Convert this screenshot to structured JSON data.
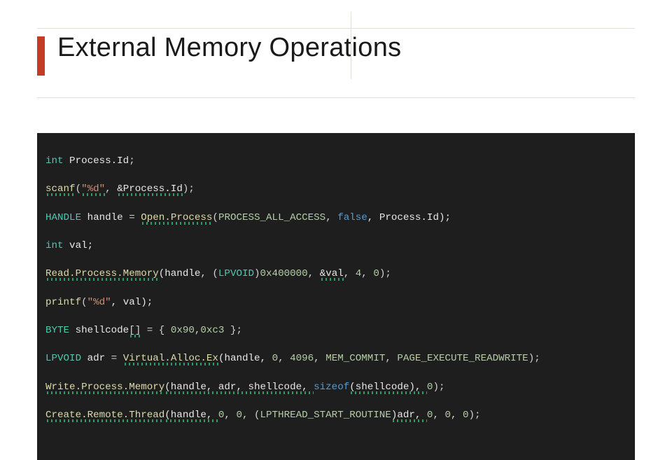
{
  "title": "External Memory Operations",
  "code": {
    "l1": {
      "a": "int",
      "b": " Process.Id",
      "c": ";"
    },
    "l2": {
      "a": "scanf",
      "b": "(",
      "c": "\"%d\"",
      "d": ", ",
      "e": "&Process.Id",
      "f": ");"
    },
    "l3": {
      "a": "HANDLE",
      "b": " handle ",
      "eq": "= ",
      "c": "Open.Process",
      "d": "(",
      "e": "PROCESS_ALL_ACCESS",
      "f": ", ",
      "g": "false",
      "h": ", Process.Id);"
    },
    "l4": {
      "a": "int",
      "b": " val;"
    },
    "l5": {
      "a": "Read.Process.Memory",
      "b": "(handle",
      "c": ", (",
      "d": "LPVOID",
      "e": ")",
      "f": "0x400000",
      "g": ", ",
      "h": "&val",
      "i": ", ",
      "j": "4",
      "k": ", ",
      "l": "0",
      "m": ");"
    },
    "l6": {
      "a": "printf",
      "b": "(",
      "c": "\"%d\"",
      "d": ", val);"
    },
    "l7": {
      "a": "BYTE",
      "b": " shellcode",
      "br": "[]",
      "c": " = { ",
      "d": "0x90",
      "e": ",",
      "f": "0xc3",
      "g": " };"
    },
    "l8": {
      "a": "LPVOID",
      "b": " adr ",
      "eq": "= ",
      "c": "Virtual.Alloc.Ex",
      "d": "(handle, ",
      "e": "0",
      "f": ", ",
      "g": "4096",
      "h": ", ",
      "i": "MEM_COMMIT",
      "j": ", ",
      "k": "PAGE_EXECUTE_READWRITE",
      "l": ");"
    },
    "l9": {
      "a": "Write.Process.Memory",
      "b": "(handle, adr, shellcode, ",
      "c": "sizeof",
      "d": "(shellcode), ",
      "e": "0",
      "f": ");"
    },
    "l10": {
      "a": "Create.Remote.Thread",
      "b": "(handle, ",
      "c": "0",
      "d": ", ",
      "e": "0",
      "f": ", (",
      "g": "LPTHREAD_START_ROUTINE",
      "h": ")adr, ",
      "i": "0",
      "j": ", ",
      "k": "0",
      "l": ", ",
      "m": "0",
      "n": ");"
    }
  }
}
